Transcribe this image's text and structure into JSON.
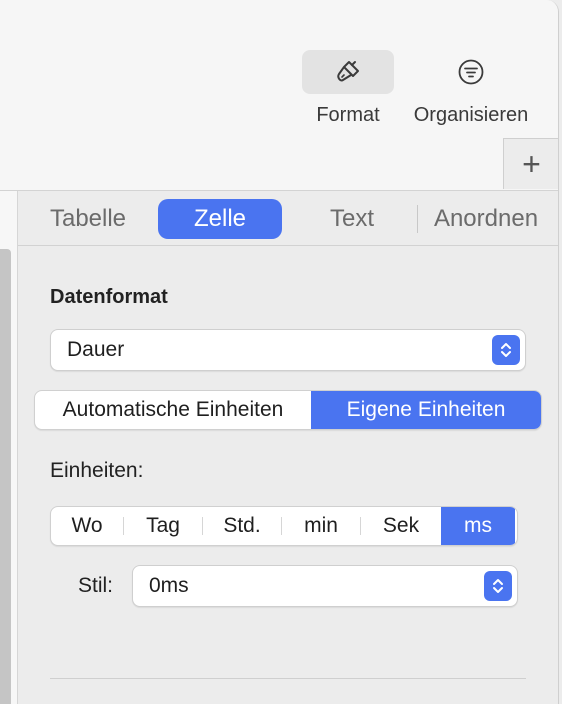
{
  "toolbar": {
    "format_label": "Format",
    "format_icon": "paintbrush-icon",
    "organize_label": "Organisieren",
    "organize_icon": "filter-lines-icon",
    "add_label": "+"
  },
  "inspector": {
    "tabs": [
      {
        "label": "Tabelle",
        "selected": false
      },
      {
        "label": "Zelle",
        "selected": true
      },
      {
        "label": "Text",
        "selected": false
      },
      {
        "label": "Anordnen",
        "selected": false
      }
    ],
    "data_format": {
      "title": "Datenformat",
      "selected": "Dauer"
    },
    "unit_mode": {
      "options": [
        "Automatische Einheiten",
        "Eigene Einheiten"
      ],
      "selected": "Eigene Einheiten"
    },
    "units": {
      "label": "Einheiten:",
      "options": [
        "Wo",
        "Tag",
        "Std.",
        "min",
        "Sek",
        "ms"
      ],
      "selected": "ms"
    },
    "style": {
      "label": "Stil:",
      "selected": "0ms"
    }
  },
  "colors": {
    "accent": "#4a74f0",
    "panel": "#ececec",
    "toolbar": "#f6f6f6"
  }
}
